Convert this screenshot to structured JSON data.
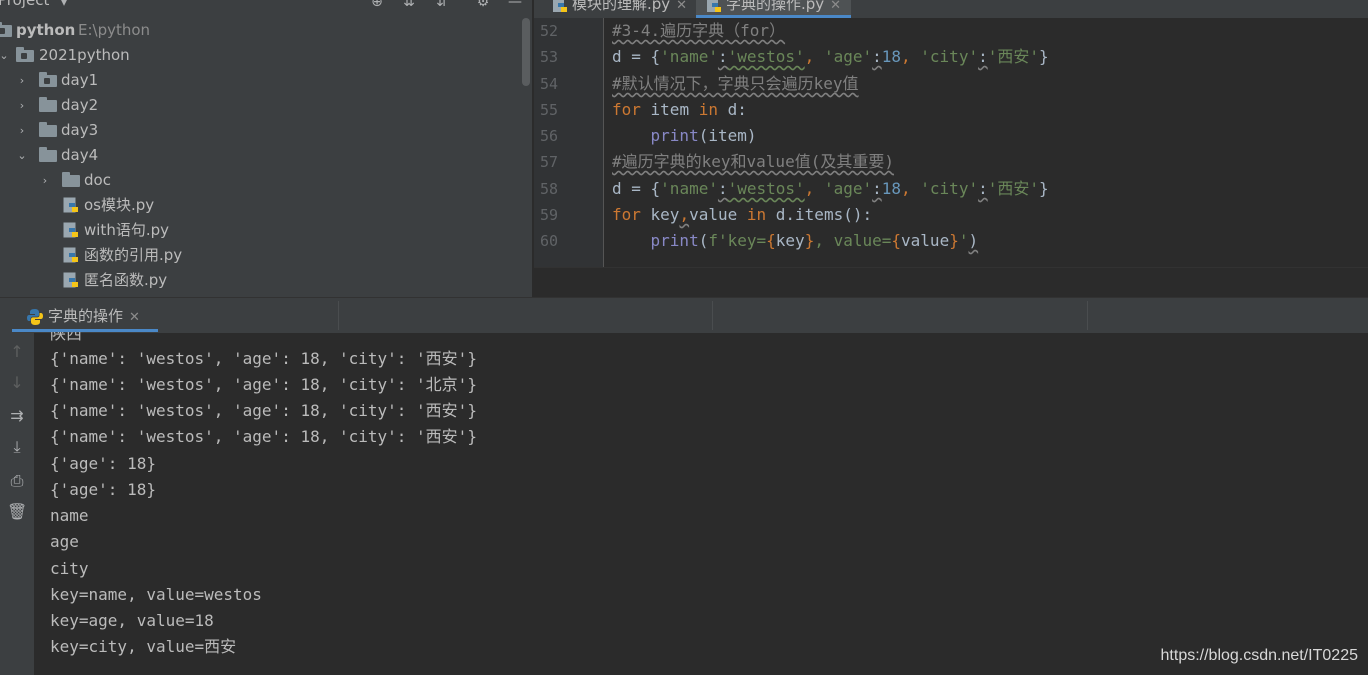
{
  "project_panel": {
    "title": "Project",
    "root": {
      "name": "python",
      "path": "E:\\python"
    },
    "items": [
      {
        "label": "2021python",
        "expanded": true,
        "kind": "module-folder"
      },
      {
        "label": "day1",
        "expanded": false,
        "kind": "module-folder"
      },
      {
        "label": "day2",
        "expanded": false,
        "kind": "folder"
      },
      {
        "label": "day3",
        "expanded": false,
        "kind": "folder"
      },
      {
        "label": "day4",
        "expanded": true,
        "kind": "folder"
      },
      {
        "label": "doc",
        "expanded": false,
        "kind": "folder"
      },
      {
        "label": "os模块.py",
        "kind": "python-file"
      },
      {
        "label": "with语句.py",
        "kind": "python-file"
      },
      {
        "label": "函数的引用.py",
        "kind": "python-file"
      },
      {
        "label": "匿名函数.py",
        "kind": "python-file"
      }
    ]
  },
  "editor": {
    "tabs": [
      {
        "label": "模块的理解.py",
        "active": false
      },
      {
        "label": "字典的操作.py",
        "active": true
      }
    ],
    "line_numbers": [
      "52",
      "53",
      "54",
      "55",
      "56",
      "57",
      "58",
      "59",
      "60"
    ],
    "code": {
      "l52_comment": "#3-4.遍历字典（for）",
      "l53_d": "d = ",
      "l53_open": "{",
      "l53_k1": "'name'",
      "l53_c1": ":",
      "l53_v1": "'westos'",
      "l53_s1": ", ",
      "l53_k2": "'age'",
      "l53_c2": ":",
      "l53_v2": "18",
      "l53_s2": ", ",
      "l53_k3": "'city'",
      "l53_c3": ":",
      "l53_v3": "'西安'",
      "l53_close": "}",
      "l54_comment": "#默认情况下，字典只会遍历key值",
      "l55_for": "for",
      "l55_item": " item ",
      "l55_in": "in",
      "l55_d": " d:",
      "l56_indent": "    ",
      "l56_print": "print",
      "l56_arg": "(item)",
      "l57_comment": "#遍历字典的key和value值(及其重要)",
      "l58_d": "d = ",
      "l58_open": "{",
      "l58_k1": "'name'",
      "l58_c1": ":",
      "l58_v1": "'westos'",
      "l58_s1": ", ",
      "l58_k2": "'age'",
      "l58_c2": ":",
      "l58_v2": "18",
      "l58_s2": ", ",
      "l58_k3": "'city'",
      "l58_c3": ":",
      "l58_v3": "'西安'",
      "l58_close": "}",
      "l59_for": "for",
      "l59_key": " key",
      "l59_comma": ",",
      "l59_value": "value ",
      "l59_in": "in",
      "l59_rest": " d.items():",
      "l60_indent": "    ",
      "l60_print": "print",
      "l60_open": "(",
      "l60_f1": "f'key=",
      "l60_b1o": "{",
      "l60_key": "key",
      "l60_b1c": "}",
      "l60_f2": ", value=",
      "l60_b2o": "{",
      "l60_value": "value",
      "l60_b2c": "}",
      "l60_f3": "'",
      "l60_close": ")"
    }
  },
  "run_panel": {
    "tab_label": "字典的操作",
    "output_lines": [
      "陕西",
      "{'name': 'westos', 'age': 18, 'city': '西安'}",
      "{'name': 'westos', 'age': 18, 'city': '北京'}",
      "{'name': 'westos', 'age': 18, 'city': '西安'}",
      "{'name': 'westos', 'age': 18, 'city': '西安'}",
      "{'age': 18}",
      "{'age': 18}",
      "name",
      "age",
      "city",
      "key=name, value=westos",
      "key=age, value=18",
      "key=city, value=西安"
    ]
  },
  "watermark": "https://blog.csdn.net/IT0225",
  "colors": {
    "keyword": "#cc7832",
    "string": "#6a8759",
    "number": "#6897bb",
    "comment": "#808080",
    "builtin": "#8888c6",
    "accent": "#4a88c7"
  }
}
